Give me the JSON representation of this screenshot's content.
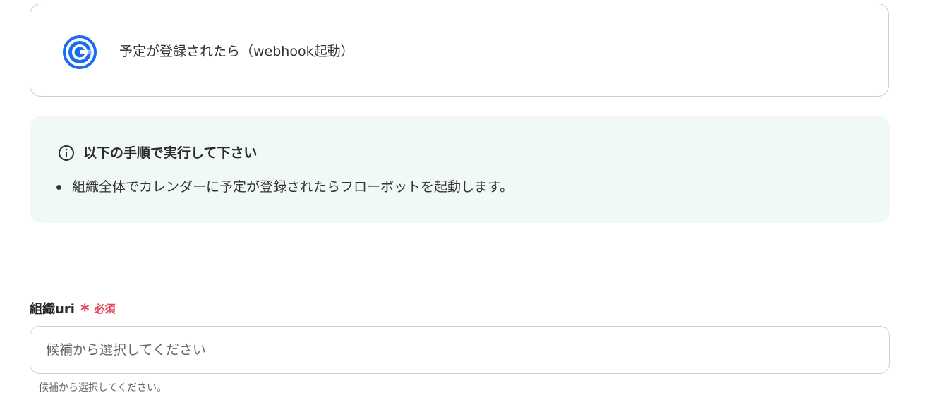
{
  "trigger": {
    "icon": "calendly-logo-icon",
    "label": "予定が登録されたら（webhook起動）",
    "icon_color": "#1a6cf0"
  },
  "info": {
    "icon": "info-circle-icon",
    "title": "以下の手順で実行して下さい",
    "items": [
      "組織全体でカレンダーに予定が登録されたらフローボットを起動します。"
    ],
    "background": "#f1f9f8"
  },
  "field": {
    "label": "組織uri",
    "required_mark": "*",
    "required_text": "必須",
    "required_color": "#e0475b",
    "placeholder": "候補から選択してください",
    "help": "候補から選択してください。"
  }
}
